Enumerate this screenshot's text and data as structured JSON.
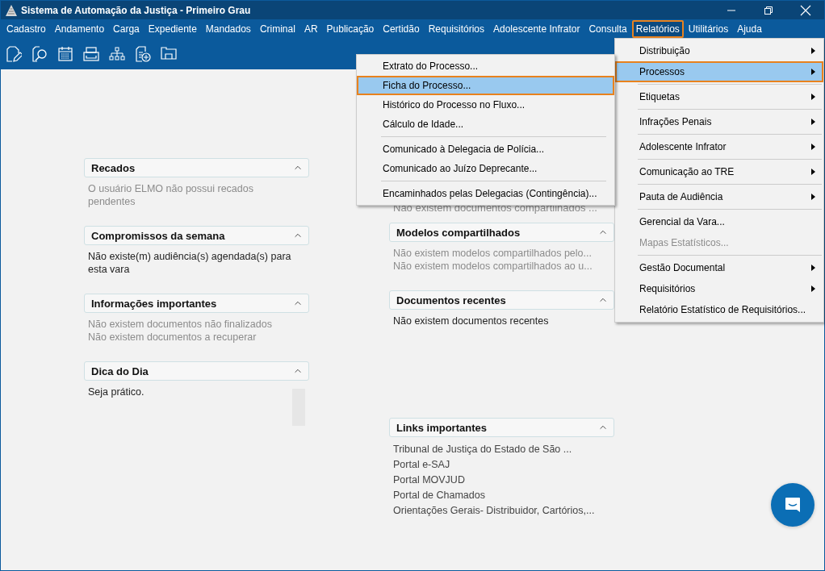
{
  "window": {
    "title": "Sistema de Automação da Justiça - Primeiro Grau"
  },
  "menubar": [
    {
      "label": "Cadastro",
      "selected": false
    },
    {
      "label": "Andamento",
      "selected": false
    },
    {
      "label": "Carga",
      "selected": false
    },
    {
      "label": "Expediente",
      "selected": false
    },
    {
      "label": "Mandados",
      "selected": false
    },
    {
      "label": "Criminal",
      "selected": false
    },
    {
      "label": "AR",
      "selected": false
    },
    {
      "label": "Publicação",
      "selected": false
    },
    {
      "label": "Certidão",
      "selected": false
    },
    {
      "label": "Requisitórios",
      "selected": false
    },
    {
      "label": "Adolescente Infrator",
      "selected": false
    },
    {
      "label": "Consulta",
      "selected": false
    },
    {
      "label": "Relatórios",
      "selected": true
    },
    {
      "label": "Utilitários",
      "selected": false
    },
    {
      "label": "Ajuda",
      "selected": false
    }
  ],
  "toolbar": [
    {
      "kind": "edit"
    },
    {
      "kind": "search"
    },
    {
      "kind": "calendar"
    },
    {
      "kind": "print"
    },
    {
      "kind": "hierarchy"
    },
    {
      "kind": "add"
    },
    {
      "kind": "folder"
    }
  ],
  "left_panels": [
    {
      "title": "Recados",
      "expanded": true,
      "lines": [
        "O usuário ELMO não possui recados pendentes"
      ],
      "muted": true
    },
    {
      "title": "Compromissos da semana",
      "expanded": true,
      "lines": [
        "Não existe(m) audiência(s) agendada(s) para esta vara"
      ],
      "muted": false
    },
    {
      "title": "Informações importantes",
      "expanded": true,
      "lines": [
        "Não existem documentos não finalizados",
        "Não existem documentos a recuperar"
      ],
      "muted": true
    },
    {
      "title": "Dica do Dia",
      "expanded": true,
      "lines": [
        "Seja prático."
      ],
      "muted": false,
      "scrollbar": true
    }
  ],
  "middle_partial_lines": [
    "Não existem documentos compartilhados ..."
  ],
  "middle_panels": [
    {
      "title": "Modelos compartilhados",
      "expanded": true,
      "lines": [
        "Não existem modelos compartilhados pelo...",
        "Não existem modelos compartilhados ao u..."
      ],
      "muted": true
    },
    {
      "title": "Documentos recentes",
      "expanded": true,
      "lines": [
        "Não existem documentos recentes"
      ],
      "muted": false
    },
    {
      "title": "Links importantes",
      "expanded": true,
      "lines": [
        "Tribunal de Justiça do Estado de São ...",
        "Portal e-SAJ",
        "Portal MOVJUD",
        "Portal de Chamados",
        "Orientações Gerais- Distribuidor, Cartórios,..."
      ],
      "muted": false,
      "links": true
    }
  ],
  "relatorios_menu": [
    {
      "kind": "item",
      "label": "Distribuição",
      "submenu": true,
      "selected": false,
      "disabled": false
    },
    {
      "kind": "item",
      "label": "Processos",
      "submenu": true,
      "selected": true,
      "disabled": false
    },
    {
      "kind": "separator"
    },
    {
      "kind": "item",
      "label": "Etiquetas",
      "submenu": true,
      "selected": false,
      "disabled": false
    },
    {
      "kind": "separator"
    },
    {
      "kind": "item",
      "label": "Infrações Penais",
      "submenu": true,
      "selected": false,
      "disabled": false
    },
    {
      "kind": "separator"
    },
    {
      "kind": "item",
      "label": "Adolescente Infrator",
      "submenu": true,
      "selected": false,
      "disabled": false
    },
    {
      "kind": "separator"
    },
    {
      "kind": "item",
      "label": "Comunicação ao TRE",
      "submenu": true,
      "selected": false,
      "disabled": false
    },
    {
      "kind": "separator"
    },
    {
      "kind": "item",
      "label": "Pauta de Audiência",
      "submenu": true,
      "selected": false,
      "disabled": false
    },
    {
      "kind": "separator"
    },
    {
      "kind": "item",
      "label": "Gerencial da Vara...",
      "submenu": false,
      "selected": false,
      "disabled": false
    },
    {
      "kind": "item",
      "label": "Mapas Estatísticos...",
      "submenu": false,
      "selected": false,
      "disabled": true
    },
    {
      "kind": "separator"
    },
    {
      "kind": "item",
      "label": "Gestão Documental",
      "submenu": true,
      "selected": false,
      "disabled": false
    },
    {
      "kind": "item",
      "label": "Requisitórios",
      "submenu": true,
      "selected": false,
      "disabled": false
    },
    {
      "kind": "item",
      "label": "Relatório Estatístico de Requisitórios...",
      "submenu": false,
      "selected": false,
      "disabled": false
    }
  ],
  "processos_submenu": [
    {
      "kind": "item",
      "label": "Extrato do Processo...",
      "selected": false
    },
    {
      "kind": "item",
      "label": "Ficha do Processo...",
      "selected": true
    },
    {
      "kind": "item",
      "label": "Histórico do Processo no Fluxo...",
      "selected": false
    },
    {
      "kind": "item",
      "label": "Cálculo de Idade...",
      "selected": false
    },
    {
      "kind": "separator"
    },
    {
      "kind": "item",
      "label": "Comunicado à Delegacia de Polícia...",
      "selected": false
    },
    {
      "kind": "item",
      "label": "Comunicado ao Juízo Deprecante...",
      "selected": false
    },
    {
      "kind": "separator"
    },
    {
      "kind": "item",
      "label": "Encaminhados pelas Delegacias (Contingência)...",
      "selected": false
    }
  ],
  "chat_button": {
    "visible": true
  }
}
